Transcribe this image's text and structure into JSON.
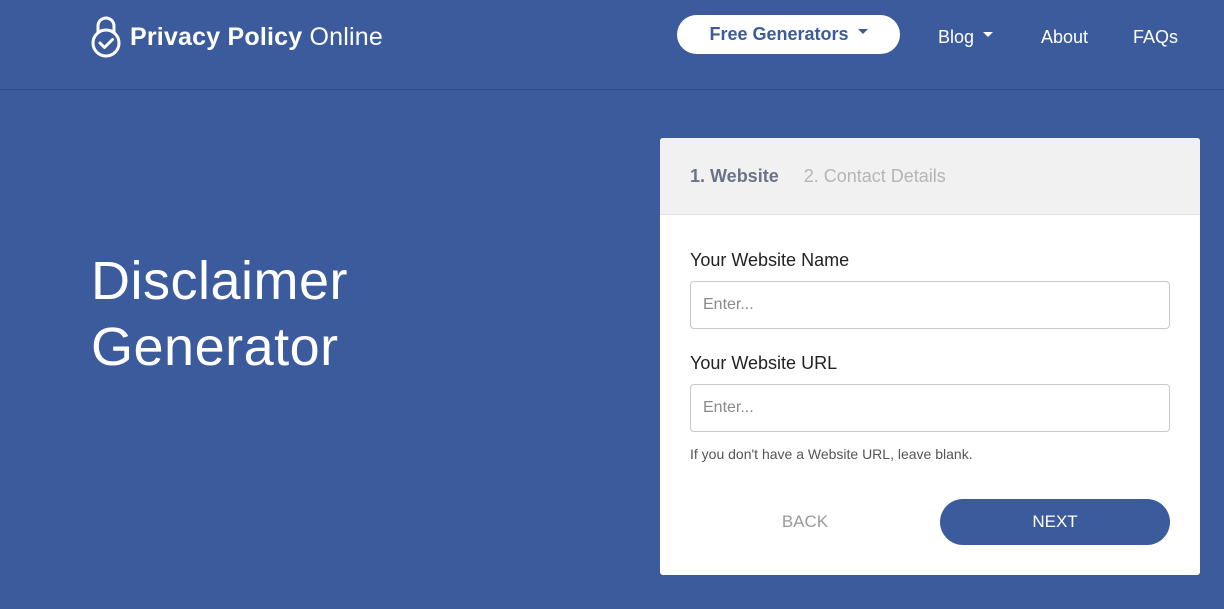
{
  "brand": {
    "name_bold": "Privacy Policy",
    "name_light": "Online",
    "logo_icon": "padlock-check-icon"
  },
  "nav": {
    "generators_label": "Free Generators",
    "blog_label": "Blog",
    "about_label": "About",
    "faqs_label": "FAQs"
  },
  "hero": {
    "title_line1": "Disclaimer",
    "title_line2": "Generator"
  },
  "form": {
    "steps": [
      {
        "label": "1. Website",
        "active": true
      },
      {
        "label": "2. Contact Details",
        "active": false
      }
    ],
    "website_name": {
      "label": "Your Website Name",
      "placeholder": "Enter...",
      "value": ""
    },
    "website_url": {
      "label": "Your Website URL",
      "placeholder": "Enter...",
      "value": ""
    },
    "url_help": "If you don't have a Website URL, leave blank.",
    "back_label": "BACK",
    "next_label": "NEXT"
  },
  "colors": {
    "brand_blue": "#3c5b9d",
    "white": "#ffffff",
    "header_gray": "#f1f1f1"
  }
}
